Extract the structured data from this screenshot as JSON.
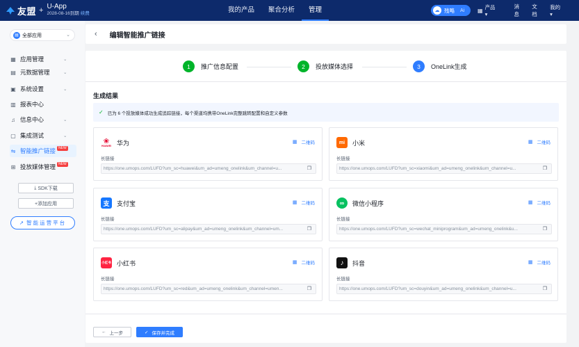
{
  "brand": {
    "logo_text": "友盟",
    "plus": "+",
    "app_name": "U-App",
    "expiry": "2028-08-16到期",
    "renew": "续费"
  },
  "topnav": [
    {
      "label": "我的产品"
    },
    {
      "label": "聚合分析"
    },
    {
      "label": "管理"
    }
  ],
  "ai_pill": {
    "label": "残略",
    "suffix": "Ai"
  },
  "rightnav": {
    "products": "产品",
    "messages": "消息",
    "docs": "文档",
    "mine": "我的"
  },
  "sidebar": {
    "app_select": "全部应用",
    "items": [
      {
        "label": "应用管理",
        "icon": "grid-icon"
      },
      {
        "label": "元数据管理",
        "icon": "database-icon"
      },
      {
        "label": "系统设置",
        "icon": "settings-icon"
      },
      {
        "label": "报表中心",
        "icon": "report-icon"
      },
      {
        "label": "信息中心",
        "icon": "bell-icon"
      },
      {
        "label": "集成测试",
        "icon": "test-icon"
      },
      {
        "label": "智能推广链接",
        "icon": "link-icon",
        "badge": "NEW"
      },
      {
        "label": "投放媒体管理",
        "icon": "media-icon",
        "badge": "NEW"
      }
    ],
    "sdk_download": "SDK下载",
    "add_app": "+添加应用",
    "ops_platform": "智能运营平台"
  },
  "header": {
    "title": "编辑智能推广链接"
  },
  "steps": [
    {
      "num": "1",
      "label": "推广信息配置",
      "color": "#00b42a"
    },
    {
      "num": "2",
      "label": "投放媒体选择",
      "color": "#00b42a"
    },
    {
      "num": "3",
      "label": "OneLink生成",
      "color": "#2f7dff"
    }
  ],
  "result": {
    "title": "生成结果",
    "banner": "已为 6 个投放媒体成功生成追踪链接，每个渠道均携带OneLink完整跳转配置和自定义参数"
  },
  "platforms": [
    {
      "name": "华为",
      "logo": "HUAWEI",
      "logo_color": "#e4002b",
      "qr": "二维码",
      "link_label": "长链接",
      "url": "https://one.umops.com/LUFD?um_sc=huawei&um_ad=umeng_onelink&um_channel=u..."
    },
    {
      "name": "小米",
      "logo": "mi",
      "logo_color": "#ff6900",
      "qr": "二维码",
      "link_label": "长链接",
      "url": "https://one.umops.com/LUFD?um_sc=xiaomi&um_ad=umeng_onelink&um_channel=u..."
    },
    {
      "name": "支付宝",
      "logo": "支",
      "logo_color": "#1677ff",
      "qr": "二维码",
      "link_label": "长链接",
      "url": "https://one.umops.com/LUFD?um_sc=alipay&um_ad=umeng_onelink&um_channel=um..."
    },
    {
      "name": "微信小程序",
      "logo": "∞",
      "logo_color": "#07c160",
      "qr": "二维码",
      "link_label": "长链接",
      "url": "https://one.umops.com/LUFD?um_sc=wechat_miniprogram&um_ad=umeng_onelink&u..."
    },
    {
      "name": "小红书",
      "logo": "小红书",
      "logo_color": "#ff2442",
      "qr": "二维码",
      "link_label": "长链接",
      "url": "https://one.umops.com/LUFD?um_sc=red&um_ad=umeng_onelink&um_channel=umen..."
    },
    {
      "name": "抖音",
      "logo": "♪",
      "logo_color": "#111111",
      "qr": "二维码",
      "link_label": "长链接",
      "url": "https://one.umops.com/LUFD?um_sc=douyin&um_ad=umeng_onelink&um_channel=u..."
    }
  ],
  "footer": {
    "prev": "上一步",
    "prev_arrow": "←",
    "save": "保存并完成",
    "save_check": "✓"
  }
}
